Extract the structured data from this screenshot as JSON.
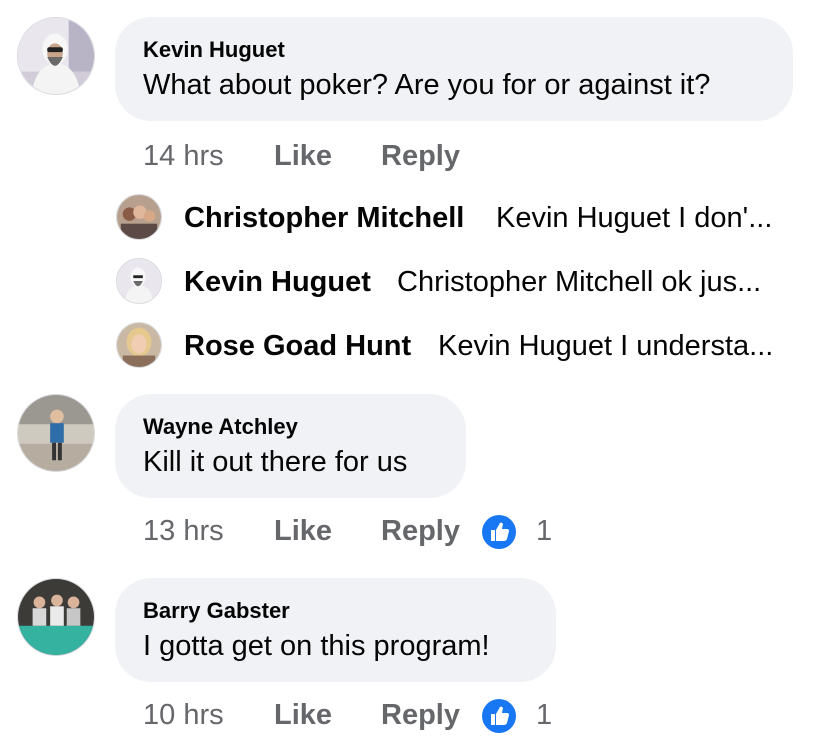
{
  "comments": [
    {
      "author": "Kevin Huguet",
      "text": "What about poker? Are you for or against it?",
      "time": "14 hrs",
      "like_label": "Like",
      "reply_label": "Reply",
      "replies": [
        {
          "author": "Christopher Mitchell",
          "text": "Kevin Huguet I don'..."
        },
        {
          "author": "Kevin Huguet",
          "text": "Christopher Mitchell ok jus..."
        },
        {
          "author": "Rose Goad Hunt",
          "text": "Kevin Huguet I understa..."
        }
      ]
    },
    {
      "author": "Wayne Atchley",
      "text": "Kill it out there for us",
      "time": "13 hrs",
      "like_label": "Like",
      "reply_label": "Reply",
      "reaction_icon": "thumbs-up-icon",
      "reaction_count": "1"
    },
    {
      "author": "Barry Gabster",
      "text": "I gotta get on this program!",
      "time": "10 hrs",
      "like_label": "Like",
      "reply_label": "Reply",
      "reaction_icon": "thumbs-up-icon",
      "reaction_count": "1"
    }
  ],
  "colors": {
    "bubble": "#f0f2f5",
    "meta_text": "#65676b",
    "like_blue": "#1877f2"
  }
}
